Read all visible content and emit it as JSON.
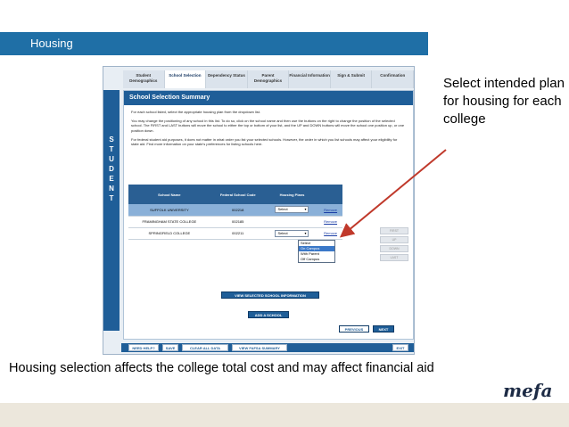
{
  "slide": {
    "title": "Housing",
    "callout": "Select intended plan for housing for each college",
    "caption": "Housing selection affects the college total cost and may affect financial aid",
    "logo": "mefa"
  },
  "colors": {
    "accent": "#1f6fa6",
    "arrow": "#c0392b",
    "panel_blue": "#1f5e98",
    "band": "#ece7dc"
  },
  "tabs": [
    {
      "label": "Student Demographics"
    },
    {
      "label": "School Selection"
    },
    {
      "label": "Dependency Status"
    },
    {
      "label": "Parent Demographics"
    },
    {
      "label": "Financial Information"
    },
    {
      "label": "Sign & Submit"
    },
    {
      "label": "Confirmation"
    }
  ],
  "sidebar": {
    "letters": [
      "S",
      "T",
      "U",
      "D",
      "E",
      "N",
      "T"
    ]
  },
  "panel": {
    "title": "School Selection Summary",
    "p1": "For each school listed, select the appropriate housing plan from the dropdown list.",
    "p2": "You may change the positioning of any school in this list. To do so, click on the school name and then use the buttons on the right to change the position of the selected school. The FIRST and LAST buttons will move the school to either the top or bottom of your list, and the UP and DOWN buttons will move the school one position up, or one position down.",
    "p3": "For federal student aid purposes, it does not matter in what order you list your selected schools. However, the order in which you list schools may affect your eligibility for state aid. Find more information on your state's preferences for listing schools here."
  },
  "table": {
    "headers": [
      "School Name",
      "Federal School Code",
      "Housing Plans",
      ""
    ],
    "rows": [
      {
        "name": "SUFFOLK UNIVERSITY",
        "code": "002218",
        "plan": "Select",
        "remove": "Remove"
      },
      {
        "name": "FRAMINGHAM STATE COLLEGE",
        "code": "002185",
        "plan": "",
        "remove": "Remove"
      },
      {
        "name": "SPRINGFIELD COLLEGE",
        "code": "002211",
        "plan": "Select",
        "remove": "Remove"
      }
    ]
  },
  "dropdown": {
    "options": [
      "Select",
      "On Campus",
      "With Parent",
      "Off Campus"
    ]
  },
  "move_buttons": [
    "FIRST",
    "UP",
    "DOWN",
    "LAST"
  ],
  "actions": {
    "view_selected": "VIEW SELECTED SCHOOL INFORMATION",
    "add_school": "ADD A SCHOOL",
    "previous": "PREVIOUS",
    "next": "NEXT"
  },
  "footer": {
    "need_help": "NEED HELP?",
    "save": "SAVE",
    "clear_all": "CLEAR ALL DATA",
    "view_summary": "VIEW FAFSA SUMMARY",
    "exit": "EXIT"
  }
}
